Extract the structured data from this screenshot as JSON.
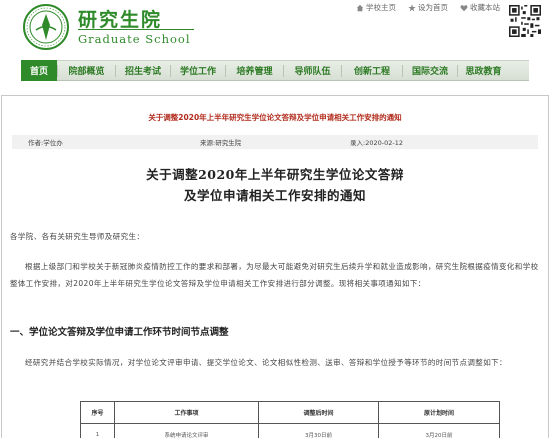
{
  "header": {
    "logo_cn": "研究生院",
    "logo_en": "Graduate School",
    "top_links": [
      "学校主页",
      "设为首页",
      "收藏本站"
    ],
    "brand_color": "#2f8a2a",
    "qr_icon": "qr-code-icon"
  },
  "nav": {
    "items": [
      {
        "label": "首页",
        "active": true
      },
      {
        "label": "院部概览",
        "active": false
      },
      {
        "label": "招生考试",
        "active": false
      },
      {
        "label": "学位工作",
        "active": false
      },
      {
        "label": "培养管理",
        "active": false
      },
      {
        "label": "导师队伍",
        "active": false
      },
      {
        "label": "创新工程",
        "active": false
      },
      {
        "label": "国际交流",
        "active": false
      },
      {
        "label": "思政教育",
        "active": false
      }
    ]
  },
  "article": {
    "heading": "关于调整2020年上半年研究生学位论文答辩及学位申请相关工作安排的通知",
    "author": "作者:学位办",
    "source": "来源:研究生院",
    "date": "录入:2020-02-12",
    "title_line1": "关于调整2020年上半年研究生学位论文答辩",
    "title_line2": "及学位申请相关工作安排的通知",
    "greeting": "各学院、各有关研究生导师及研究生：",
    "body": "根据上级部门和学校关于新冠肺炎疫情防控工作的要求和部署，为尽最大可能避免对研究生后续升学和就业造成影响，研究生院根据疫情变化和学校整体工作安排，对2020年上半年研究生学位论文答辩及学位申请相关工作安排进行部分调整。现将相关事项通知如下：",
    "section1": "一、学位论文答辩及学位申请工作环节时间节点调整",
    "body2": "经研究并结合学校实际情况，对学位论文评审申请、提交学位论文、论文相似性检测、送审、答辩和学位授予等环节的时间节点调整如下："
  },
  "table": {
    "headers": [
      "序号",
      "工作事项",
      "调整后时间",
      "原计划时间"
    ],
    "rows": [
      [
        "1",
        "系统申请论文评审",
        "3月30日前",
        "3月20日前"
      ]
    ]
  }
}
